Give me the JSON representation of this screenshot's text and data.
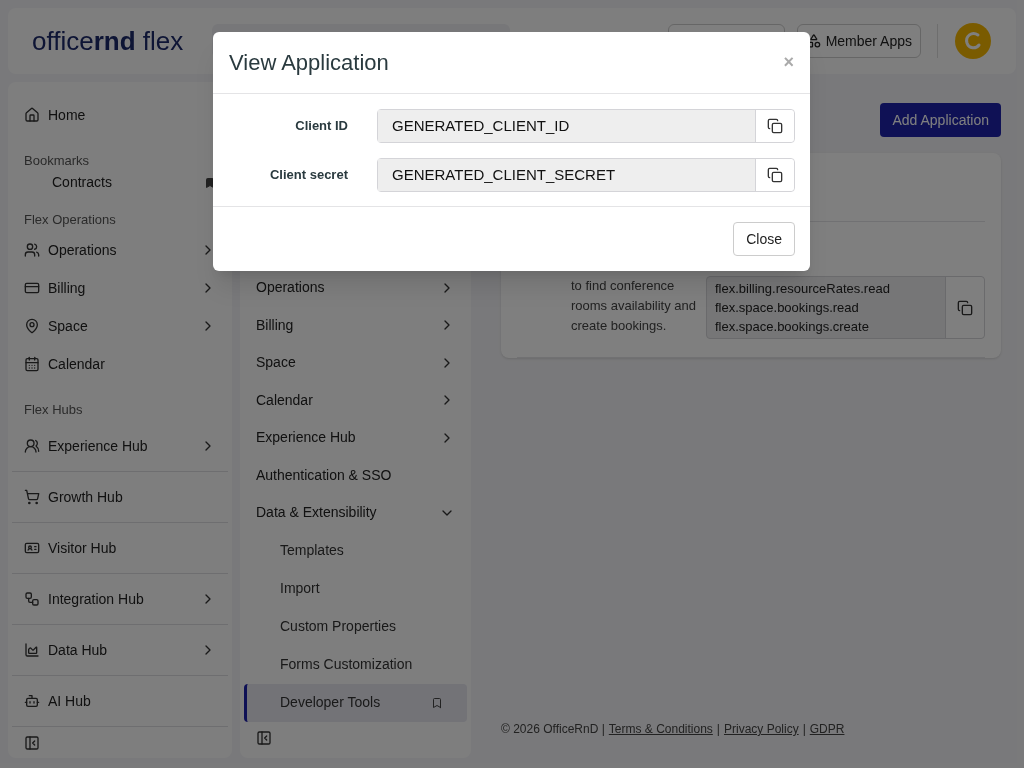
{
  "header": {
    "logo": "office**rnd** flex",
    "member_apps": "Member Apps"
  },
  "sidebar": {
    "entries": [
      {
        "kind": "item",
        "label": "Home",
        "has_submenu": false
      },
      {
        "kind": "heading",
        "label": "Bookmarks"
      },
      {
        "kind": "bookmark",
        "label": "Contracts"
      },
      {
        "kind": "heading",
        "label": "Flex Operations"
      },
      {
        "kind": "item",
        "label": "Operations",
        "has_submenu": true
      },
      {
        "kind": "item",
        "label": "Billing",
        "has_submenu": true
      },
      {
        "kind": "item",
        "label": "Space",
        "has_submenu": true
      },
      {
        "kind": "item",
        "label": "Calendar",
        "has_submenu": false
      },
      {
        "kind": "heading",
        "label": "Flex Hubs"
      },
      {
        "kind": "hub",
        "label": "Experience Hub",
        "has_submenu": true
      },
      {
        "kind": "hub",
        "label": "Growth Hub",
        "has_submenu": false
      },
      {
        "kind": "hub",
        "label": "Visitor Hub",
        "has_submenu": false
      },
      {
        "kind": "hub",
        "label": "Integration Hub",
        "has_submenu": true
      },
      {
        "kind": "hub",
        "label": "Data Hub",
        "has_submenu": true
      },
      {
        "kind": "hub",
        "label": "AI Hub",
        "has_submenu": false
      }
    ]
  },
  "settings_menu": {
    "items": [
      {
        "label": "Operations",
        "expanded": false,
        "selected": false
      },
      {
        "label": "Billing",
        "expanded": false,
        "selected": false
      },
      {
        "label": "Space",
        "expanded": false,
        "selected": false
      },
      {
        "label": "Calendar",
        "expanded": false,
        "selected": false
      },
      {
        "label": "Experience Hub",
        "expanded": false,
        "selected": false
      },
      {
        "label": "Authentication & SSO",
        "selected": false
      },
      {
        "label": "Data & Extensibility",
        "expanded": true,
        "selected": false,
        "children": [
          {
            "label": "Templates",
            "selected": false
          },
          {
            "label": "Import",
            "selected": false
          },
          {
            "label": "Custom Properties",
            "selected": false
          },
          {
            "label": "Forms Customization",
            "selected": false
          },
          {
            "label": "Developer Tools",
            "selected": true
          }
        ]
      }
    ]
  },
  "main": {
    "add_button": "Add Application",
    "application": {
      "description": "to find conference rooms availability and create bookings.",
      "scopes": [
        "flex.billing.resourceRates.read",
        "flex.space.bookings.read",
        "flex.space.bookings.create"
      ]
    }
  },
  "footer": {
    "copyright": "© 2026 OfficeRnD |",
    "links": [
      "Terms & Conditions",
      "Privacy Policy",
      "GDPR"
    ],
    "separators": [
      "|",
      "|"
    ]
  },
  "modal": {
    "title": "View Application",
    "close_icon": "×",
    "fields": [
      {
        "label": "Client ID",
        "value": "GENERATED_CLIENT_ID"
      },
      {
        "label": "Client secret",
        "value": "GENERATED_CLIENT_SECRET"
      }
    ],
    "close_button": "Close"
  }
}
